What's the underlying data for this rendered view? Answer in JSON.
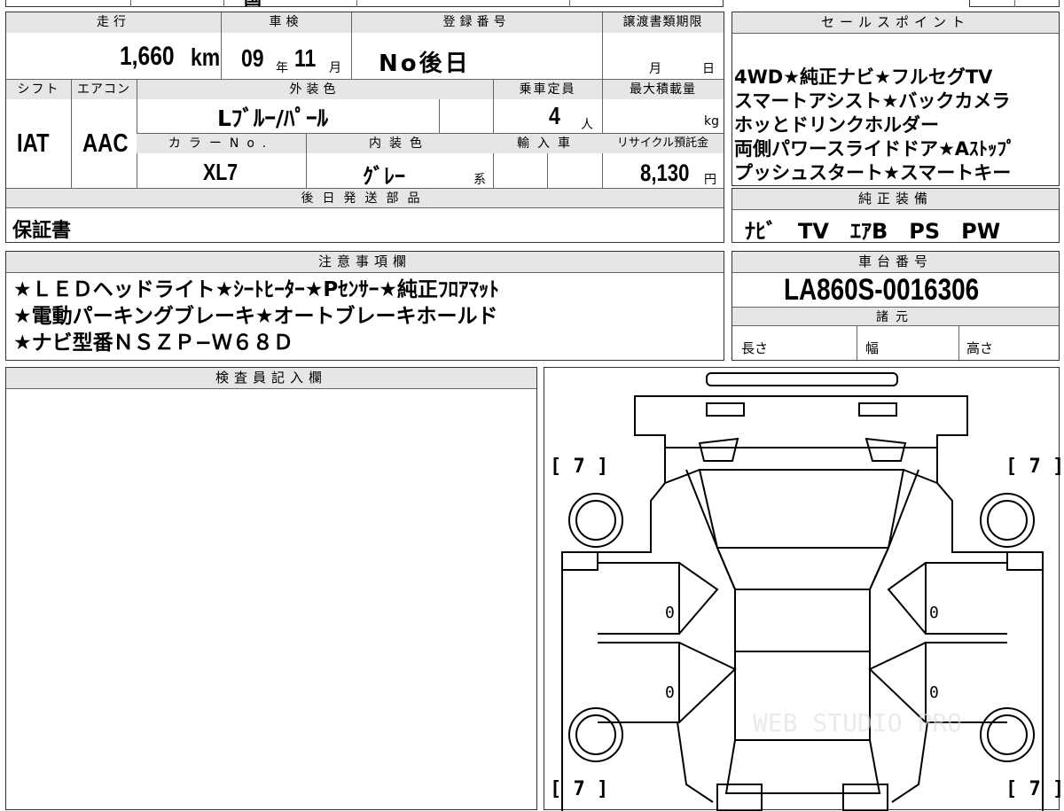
{
  "top_row_partial": "国",
  "left_table": {
    "headers_row1": [
      "走行",
      "車検",
      "登録番号",
      "譲渡書類期限"
    ],
    "mileage_value": "1,660",
    "mileage_unit": "km",
    "shaken_year": "09",
    "shaken_year_unit": "年",
    "shaken_month": "11",
    "shaken_month_unit": "月",
    "registration": "No後日",
    "transfer_month_unit": "月",
    "transfer_day_unit": "日",
    "headers_row2": [
      "シフト",
      "エアコン",
      "外装色",
      "乗車定員",
      "最大積載量"
    ],
    "shift": "IAT",
    "aircon": "AAC",
    "exterior_color": "Lﾌﾞﾙｰ/ﾊﾟｰﾙ",
    "capacity": "4",
    "capacity_unit": "人",
    "load_unit": "kg",
    "headers_row3": [
      "カラーNo.",
      "内装色",
      "輸入車",
      "リサイクル預託金"
    ],
    "color_no": "XL7",
    "interior_color": "ｸﾞﾚｰ",
    "interior_suffix": "系",
    "recycle_fee": "8,130",
    "recycle_unit": "円",
    "later_parts_header": "後日発送部品",
    "later_parts_value": "保証書"
  },
  "sales_points": {
    "header": "セールスポイント",
    "lines": [
      "4WD★純正ナビ★フルセグTV",
      "スマートアシスト★バックカメラ",
      "ホッとドリンクホルダー",
      "両側パワースライドドア★Aｽﾄｯﾌﾟ",
      "プッシュスタート★スマートキー"
    ]
  },
  "standard_equipment": {
    "header": "純正装備",
    "value": "ﾅﾋﾞ　TV　ｴｱB　PS　PW"
  },
  "notes": {
    "header": "注意事項欄",
    "lines": [
      "★ＬＥＤヘッドライト★ｼｰﾄﾋｰﾀｰ★Pｾﾝｻｰ★純正ﾌﾛｱﾏｯﾄ",
      "★電動パーキングブレーキ★オートブレーキホールド",
      "★ナビ型番ＮＳＺＰ−Ｗ６８Ｄ"
    ]
  },
  "chassis": {
    "header": "車台番号",
    "value": "LA860S-0016306",
    "specs_header": "諸元",
    "specs": [
      "長さ",
      "幅",
      "高さ"
    ]
  },
  "inspector": {
    "header": "検査員記入欄"
  },
  "diagram": {
    "tire_marks": [
      "[ 7 ]",
      "[ 7 ]",
      "[ 7 ]",
      "[ 7 ]"
    ],
    "door_marks": [
      "0",
      "0",
      "0",
      "0"
    ],
    "watermark": "WEB STUDIO PRO"
  }
}
